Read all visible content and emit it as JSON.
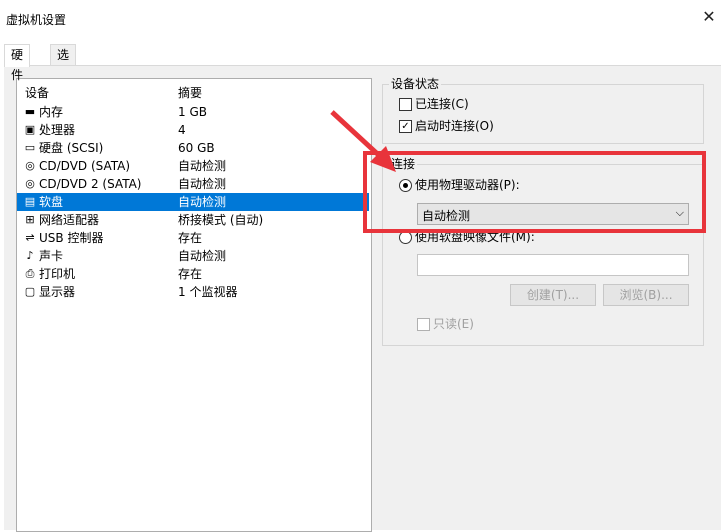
{
  "window": {
    "title": "虚拟机设置"
  },
  "tabs": [
    {
      "label": "硬件",
      "active": true
    },
    {
      "label": "选项",
      "active": false
    }
  ],
  "device_table": {
    "headers": {
      "device": "设备",
      "summary": "摘要"
    },
    "rows": [
      {
        "icon": "memory-icon",
        "name": "内存",
        "summary": "1 GB",
        "selected": false
      },
      {
        "icon": "processor-icon",
        "name": "处理器",
        "summary": "4",
        "selected": false
      },
      {
        "icon": "harddisk-icon",
        "name": "硬盘 (SCSI)",
        "summary": "60 GB",
        "selected": false
      },
      {
        "icon": "cd-icon",
        "name": "CD/DVD (SATA)",
        "summary": "自动检测",
        "selected": false
      },
      {
        "icon": "cd-icon",
        "name": "CD/DVD 2 (SATA)",
        "summary": "自动检测",
        "selected": false
      },
      {
        "icon": "floppy-icon",
        "name": "软盘",
        "summary": "自动检测",
        "selected": true
      },
      {
        "icon": "network-icon",
        "name": "网络适配器",
        "summary": "桥接模式 (自动)",
        "selected": false
      },
      {
        "icon": "usb-icon",
        "name": "USB 控制器",
        "summary": "存在",
        "selected": false
      },
      {
        "icon": "sound-icon",
        "name": "声卡",
        "summary": "自动检测",
        "selected": false
      },
      {
        "icon": "printer-icon",
        "name": "打印机",
        "summary": "存在",
        "selected": false
      },
      {
        "icon": "display-icon",
        "name": "显示器",
        "summary": "1 个监视器",
        "selected": false
      }
    ]
  },
  "device_status": {
    "label": "设备状态",
    "connected": {
      "label": "已连接(C)",
      "checked": false
    },
    "connect_on_startup": {
      "label": "启动时连接(O)",
      "checked": true
    }
  },
  "connection": {
    "label": "连接",
    "use_physical": {
      "label": "使用物理驱动器(P):",
      "selected": true
    },
    "physical_select": {
      "value": "自动检测"
    },
    "use_image": {
      "label": "使用软盘映像文件(M):",
      "selected": false
    },
    "image_path": "",
    "create_button": "创建(T)...",
    "browse_button": "浏览(B)...",
    "readonly": {
      "label": "只读(E)",
      "checked": false
    }
  },
  "colors": {
    "selection": "#0078d7",
    "annotation": "#e8343b"
  }
}
